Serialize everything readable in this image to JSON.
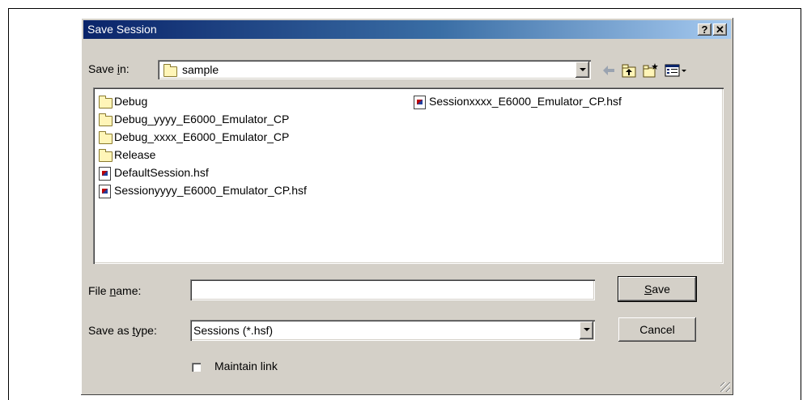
{
  "dialog": {
    "title": "Save Session",
    "help_label": "?",
    "close_label": "✕"
  },
  "save_in": {
    "label_prefix": "Save ",
    "label_underlined": "i",
    "label_suffix": "n:",
    "value": "sample"
  },
  "toolbar": {
    "icons": [
      "back-arrow-icon",
      "up-one-level-icon",
      "new-folder-icon",
      "view-menu-icon"
    ]
  },
  "files": {
    "column1": [
      {
        "name": "Debug",
        "type": "folder"
      },
      {
        "name": "Debug_yyyy_E6000_Emulator_CP",
        "type": "folder"
      },
      {
        "name": "Debug_xxxx_E6000_Emulator_CP",
        "type": "folder"
      },
      {
        "name": "Release",
        "type": "folder"
      },
      {
        "name": "DefaultSession.hsf",
        "type": "file"
      },
      {
        "name": "Sessionyyyy_E6000_Emulator_CP.hsf",
        "type": "file"
      }
    ],
    "column2": [
      {
        "name": "Sessionxxxx_E6000_Emulator_CP.hsf",
        "type": "file"
      }
    ]
  },
  "file_name": {
    "label_prefix": "File ",
    "label_underlined": "n",
    "label_suffix": "ame:",
    "value": ""
  },
  "save_as_type": {
    "label_prefix": "Save as ",
    "label_underlined": "t",
    "label_suffix": "ype:",
    "value": "Sessions (*.hsf)"
  },
  "buttons": {
    "save_underlined": "S",
    "save_rest": "ave",
    "cancel": "Cancel"
  },
  "maintain_link": {
    "label": "Maintain link",
    "checked": false
  }
}
